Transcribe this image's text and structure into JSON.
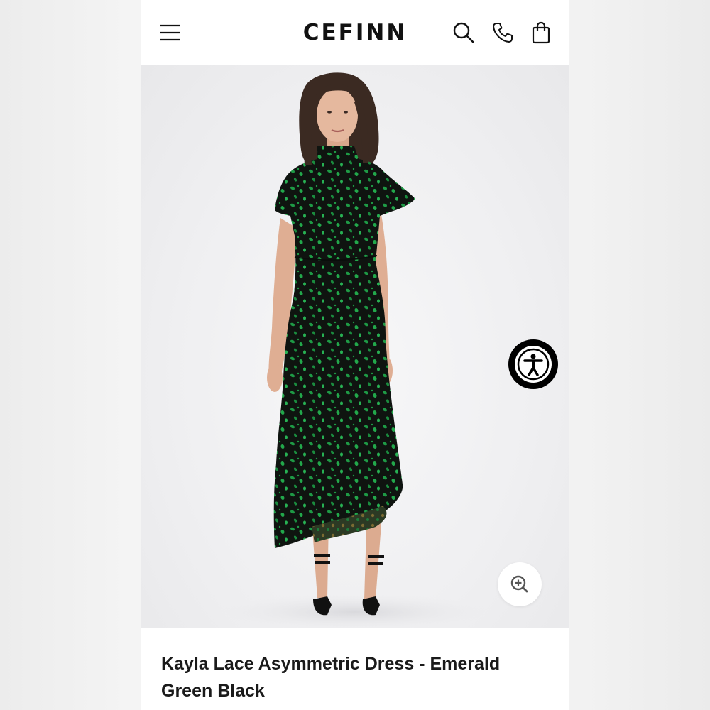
{
  "header": {
    "brand": "CEFINN",
    "menu_icon": "hamburger-menu-icon",
    "search_icon": "search-icon",
    "phone_icon": "phone-icon",
    "bag_icon": "shopping-bag-icon"
  },
  "product": {
    "image_alt": "Model wearing the Kayla Lace Asymmetric Dress in emerald green and black",
    "title": "Kayla Lace Asymmetric Dress - Emerald Green Black"
  },
  "overlays": {
    "accessibility_icon": "accessibility-icon",
    "zoom_icon": "zoom-in-icon"
  },
  "colors": {
    "brand_text": "#111111",
    "dress_black": "#0f1410",
    "dress_green": "#1e9a45",
    "background": "#f0f0f2"
  }
}
